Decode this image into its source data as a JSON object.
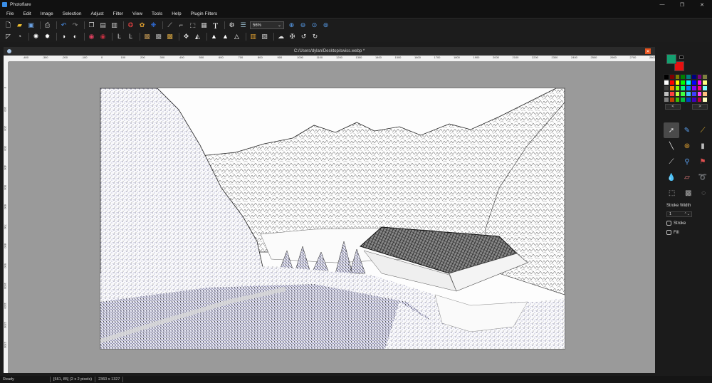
{
  "app": {
    "title": "Photoflare",
    "window_controls": [
      "—",
      "❐",
      "✕"
    ]
  },
  "menu": [
    "File",
    "Edit",
    "Image",
    "Selection",
    "Adjust",
    "Filter",
    "View",
    "Tools",
    "Help",
    "Plugin Filters"
  ],
  "toolbar": {
    "zoom_value": "56%"
  },
  "document": {
    "path": "C:/Users/dylan/Desktop/swiss.webp *",
    "ruler_top_labels": [
      "-400",
      "-300",
      "-200",
      "-100",
      "0",
      "100",
      "200",
      "300",
      "400",
      "500",
      "600",
      "700",
      "800",
      "900",
      "1000",
      "1100",
      "1200",
      "1300",
      "1400",
      "1500",
      "1600",
      "1700",
      "1800",
      "1900",
      "2000",
      "2100",
      "2200",
      "2300",
      "2400",
      "2500",
      "2600",
      "2700",
      "2800"
    ],
    "ruler_left_labels": [
      "0",
      "100",
      "200",
      "300",
      "400",
      "500",
      "600",
      "700",
      "800",
      "900",
      "1000",
      "1100",
      "1200",
      "1300"
    ]
  },
  "colors": {
    "primary": "#14a070",
    "secondary": "#e81010",
    "palette": [
      "#000000",
      "#7f0000",
      "#7f7f00",
      "#007f00",
      "#007f7f",
      "#00007f",
      "#7f007f",
      "#7f7f3f",
      "#ffffff",
      "#ff0000",
      "#ffff00",
      "#00ff00",
      "#00ffff",
      "#0000ff",
      "#ff00ff",
      "#ffff7f",
      "#3f3f3f",
      "#ff7f00",
      "#7fff00",
      "#00ff7f",
      "#007fff",
      "#7f00ff",
      "#ff007f",
      "#7fffff",
      "#bfbfbf",
      "#ff3f3f",
      "#bfff3f",
      "#3fff3f",
      "#3fbfff",
      "#3f3fff",
      "#ff3fff",
      "#ffbf7f",
      "#7f7f7f",
      "#bf3f00",
      "#3fbf00",
      "#00bf3f",
      "#0040bf",
      "#3f00bf",
      "#bf003f",
      "#ffffbf"
    ],
    "prev_label": "<",
    "next_label": ">"
  },
  "tools_panel": {
    "stroke_width_label": "Stroke Width",
    "stroke_width_value": "1",
    "stroke_label": "Stroke",
    "fill_label": "Fill"
  },
  "status": {
    "state": "Ready",
    "position": "[661, 85] (2 x 2 pixels)",
    "dimensions": "2360 x 1327"
  }
}
